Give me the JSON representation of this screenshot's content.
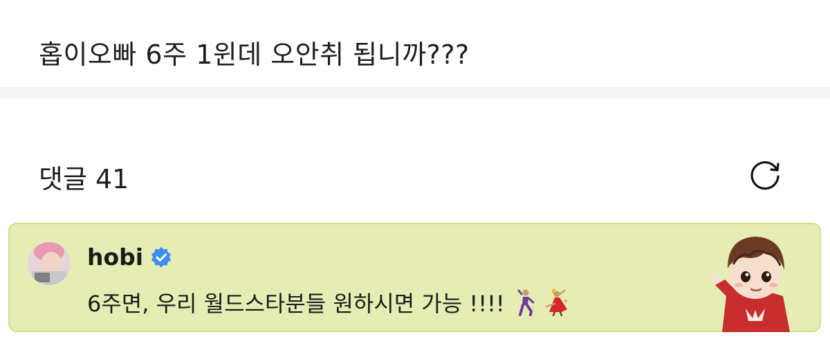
{
  "post": {
    "question": "홉이오빠 6주 1윈데 오안취 됩니까???"
  },
  "comments": {
    "header": "댓글 41",
    "refresh_icon": "refresh-icon"
  },
  "highlight_comment": {
    "author": "hobi",
    "verified_icon": "verified-badge-icon",
    "text": "6주면, 우리 월드스타분들 원하시면 가능 !!!!",
    "emojis": [
      "man-dancing-emoji",
      "woman-dancing-emoji"
    ],
    "card_bg": "#e5edb4",
    "card_border": "#cfe08a",
    "verified_color": "#3d8cf0"
  }
}
